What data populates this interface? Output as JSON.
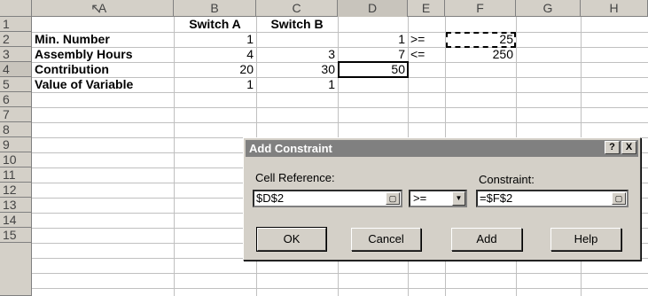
{
  "columns": [
    "A",
    "B",
    "C",
    "D",
    "E",
    "F",
    "G",
    "H"
  ],
  "rows": [
    "1",
    "2",
    "3",
    "4",
    "5",
    "6",
    "7",
    "8",
    "9",
    "10",
    "11",
    "12",
    "13",
    "14",
    "15"
  ],
  "cells": {
    "b1": "Switch A",
    "c1": "Switch B",
    "a2": "Min. Number",
    "b2": "1",
    "d2": "1",
    "e2": ">=",
    "f2": "25",
    "a3": "Assembly Hours",
    "b3": "4",
    "c3": "3",
    "d3": "7",
    "e3": "<=",
    "f3": "250",
    "a4": "Contribution",
    "b4": "20",
    "c4": "30",
    "d4": "50",
    "a5": "Value of Variable",
    "b5": "1",
    "c5": "1"
  },
  "dialog": {
    "title": "Add Constraint",
    "help_icon_label": "?",
    "close_icon_label": "X",
    "cell_reference_label": "Cell Reference:",
    "cell_reference_value": "$D$2",
    "operator_value": ">=",
    "constraint_label": "Constraint:",
    "constraint_value": "=$F$2",
    "ok_label": "OK",
    "cancel_label": "Cancel",
    "add_label": "Add",
    "help_label": "Help"
  },
  "icons": [
    "mouse-cursor-icon",
    "range-select-icon",
    "dropdown-arrow-icon",
    "help-icon",
    "close-icon"
  ],
  "colors": {
    "header_bg": "#d4d0c8",
    "grid": "#c0c0c0",
    "title_bar": "#808080"
  }
}
